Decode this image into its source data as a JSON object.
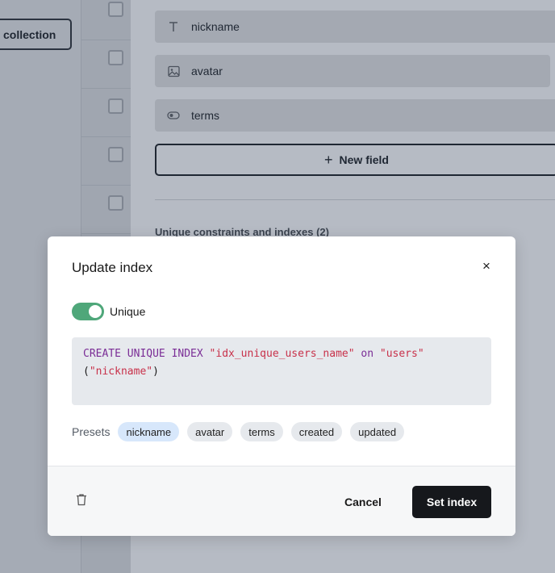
{
  "background": {
    "collection_button": "collection",
    "fields": [
      {
        "icon": "text-icon",
        "name": "nickname"
      },
      {
        "icon": "image-icon",
        "name": "avatar"
      },
      {
        "icon": "toggle-icon",
        "name": "terms"
      }
    ],
    "new_field_label": "New field",
    "constraints_title": "Unique constraints and indexes (2)"
  },
  "modal": {
    "title": "Update index",
    "close_symbol": "×",
    "unique_label": "Unique",
    "unique_enabled": true,
    "sql": {
      "kw1": "CREATE UNIQUE INDEX",
      "index_name": "\"idx_unique_users_name\"",
      "kw2": "on",
      "table": "\"users\"",
      "open_paren": "(",
      "column": "\"nickname\"",
      "close_paren": ")"
    },
    "presets_label": "Presets",
    "presets": [
      "nickname",
      "avatar",
      "terms",
      "created",
      "updated"
    ],
    "active_preset": "nickname",
    "cancel_label": "Cancel",
    "submit_label": "Set index"
  },
  "colors": {
    "toggle_on": "#4fa77a",
    "primary_button": "#16181c",
    "sql_keyword": "#7a2d96",
    "sql_string": "#c8314a",
    "active_chip": "#d7e7fb"
  }
}
